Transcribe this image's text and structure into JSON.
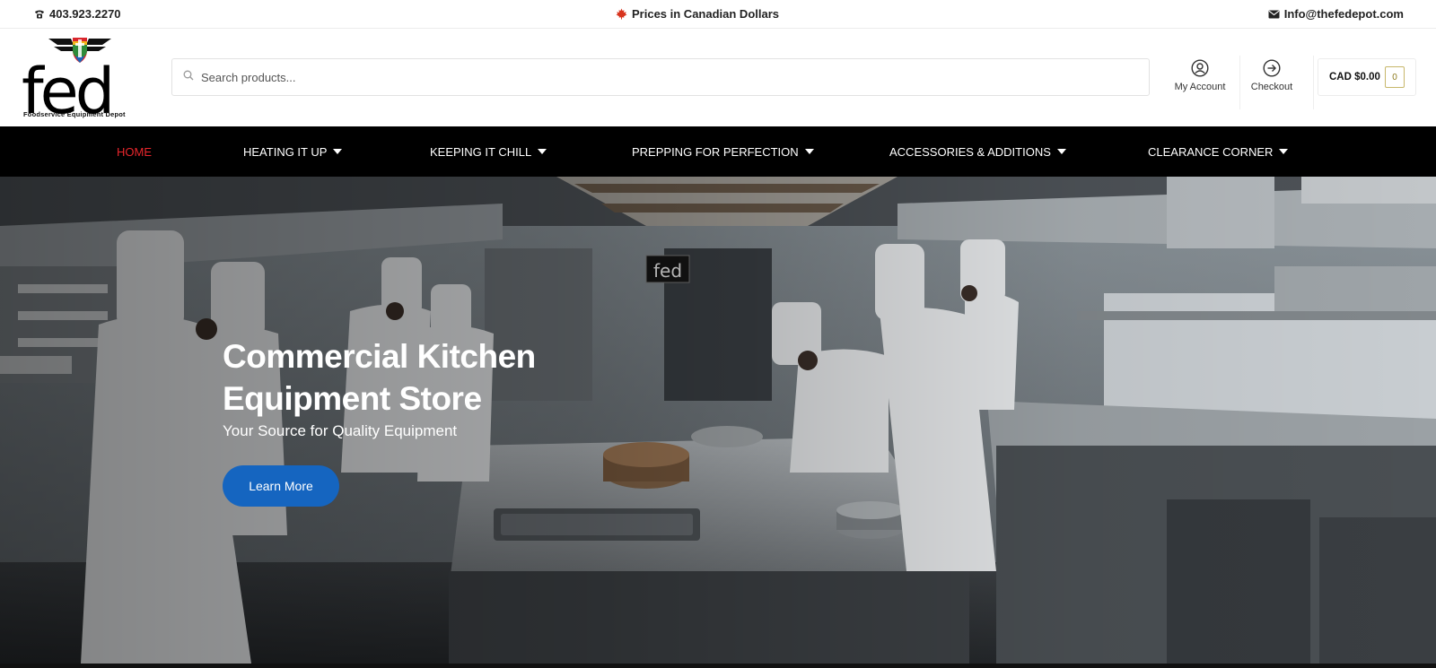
{
  "topbar": {
    "phone": "403.923.2270",
    "currency_note": "Prices in Canadian Dollars",
    "email": "Info@thefedepot.com"
  },
  "header": {
    "logo_text": "fed",
    "logo_subtitle": "Foodservice Equipment Depot",
    "search_placeholder": "Search products...",
    "my_account_label": "My Account",
    "checkout_label": "Checkout",
    "cart_total": "CAD $0.00",
    "cart_count": "0"
  },
  "nav": {
    "items": [
      {
        "label": "HOME",
        "active": true,
        "has_dropdown": false
      },
      {
        "label": "HEATING IT UP",
        "active": false,
        "has_dropdown": true
      },
      {
        "label": "KEEPING IT CHILL",
        "active": false,
        "has_dropdown": true
      },
      {
        "label": "PREPPING FOR PERFECTION",
        "active": false,
        "has_dropdown": true
      },
      {
        "label": "ACCESSORIES & ADDITIONS",
        "active": false,
        "has_dropdown": true
      },
      {
        "label": "CLEARANCE CORNER",
        "active": false,
        "has_dropdown": true
      }
    ]
  },
  "hero": {
    "title": "Commercial Kitchen Equipment Store",
    "subtitle": "Your Source for Quality Equipment",
    "button_label": "Learn More",
    "sign_text": "fed"
  },
  "colors": {
    "nav_background": "#000000",
    "nav_active": "#e8262c",
    "button_blue": "#1565c0",
    "cart_badge": "#c7b76a"
  },
  "icons": {
    "phone": "phone-icon",
    "currency": "maple-leaf-icon",
    "email": "envelope-icon",
    "search": "search-icon",
    "account": "user-circle-icon",
    "checkout": "arrow-circle-icon"
  }
}
